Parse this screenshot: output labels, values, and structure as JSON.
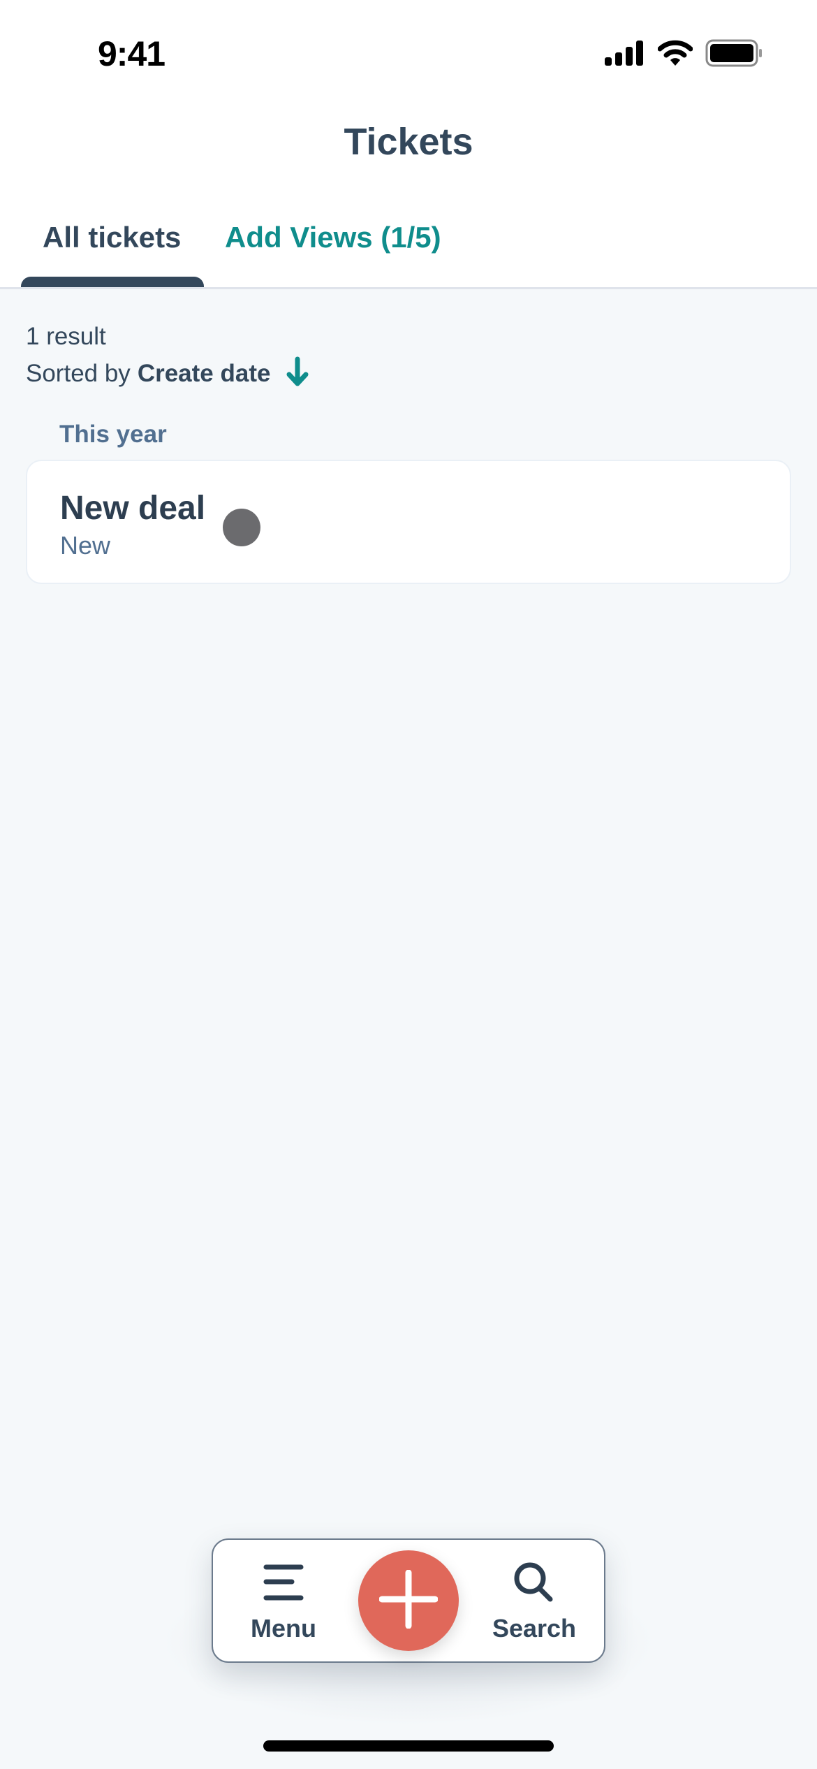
{
  "status_bar": {
    "time": "9:41",
    "icons": [
      "cellular-signal-icon",
      "wifi-icon",
      "battery-icon"
    ]
  },
  "header": {
    "title": "Tickets"
  },
  "tabs": [
    {
      "label": "All tickets",
      "active": true
    },
    {
      "label": "Add Views (1/5)",
      "active": false
    }
  ],
  "results": {
    "count_label": "1 result",
    "sort_prefix": "Sorted by",
    "sort_field": "Create date",
    "sort_direction": "descending",
    "sort_icon": "arrow-down-icon"
  },
  "groups": [
    {
      "label": "This year",
      "items": [
        {
          "title": "New deal",
          "subtitle": "New"
        }
      ]
    }
  ],
  "bottom_nav": {
    "menu_label": "Menu",
    "menu_icon": "hamburger-menu-icon",
    "add_icon": "plus-icon",
    "search_label": "Search",
    "search_icon": "search-icon"
  },
  "colors": {
    "accent_teal": "#0f8d8c",
    "text_primary": "#33475b",
    "text_secondary": "#516f90",
    "fab": "#e0685a",
    "background": "#f5f8fa"
  }
}
